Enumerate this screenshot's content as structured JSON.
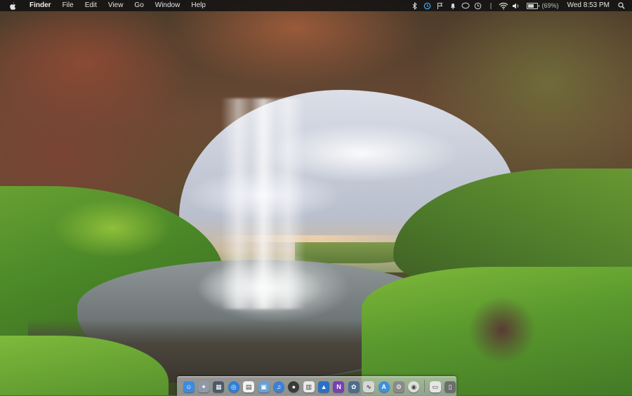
{
  "menubar": {
    "apple_icon": "apple-logo-icon",
    "items": [
      "Finder",
      "File",
      "Edit",
      "View",
      "Go",
      "Window",
      "Help"
    ],
    "status_icons": [
      "bluetooth-icon",
      "timemachine-icon",
      "flag-icon",
      "notification-bell-icon",
      "chat-icon",
      "clock-history-icon",
      "dropbox-icon",
      "wifi-icon",
      "volume-icon"
    ],
    "battery": {
      "percent_text": "(69%)",
      "level": 0.69
    },
    "clock": "Wed 8:53 PM",
    "search_icon": "spotlight-search-icon"
  },
  "dock": {
    "items": [
      {
        "name": "finder",
        "icon": "finder-icon",
        "color": "#3d8be0"
      },
      {
        "name": "launchpad",
        "icon": "launchpad-icon",
        "color": "#8f9aa8"
      },
      {
        "name": "mission-control",
        "icon": "mission-control-icon",
        "color": "#4b5a6b"
      },
      {
        "name": "safari",
        "icon": "safari-icon",
        "color": "#2f7fd8"
      },
      {
        "name": "calendar",
        "icon": "calendar-icon",
        "color": "#f2f2f2"
      },
      {
        "name": "preview",
        "icon": "preview-icon",
        "color": "#6aa0d8"
      },
      {
        "name": "itunes",
        "icon": "itunes-icon",
        "color": "#3c7fd6"
      },
      {
        "name": "photo-booth",
        "icon": "camera-icon",
        "color": "#3a3a3a"
      },
      {
        "name": "numbers",
        "icon": "numbers-icon",
        "color": "#e9e9e9"
      },
      {
        "name": "keynote",
        "icon": "keynote-icon",
        "color": "#2a6fc8"
      },
      {
        "name": "one-note",
        "icon": "onenote-icon",
        "color": "#7a3fb0"
      },
      {
        "name": "photos",
        "icon": "photos-icon",
        "color": "#4d6d8e"
      },
      {
        "name": "grapher",
        "icon": "grapher-icon",
        "color": "#d7d7d7"
      },
      {
        "name": "app-store",
        "icon": "app-store-icon",
        "color": "#3f8fe0"
      },
      {
        "name": "system-preferences",
        "icon": "system-preferences-icon",
        "color": "#8a8a8a"
      },
      {
        "name": "chrome",
        "icon": "chrome-icon",
        "color": "#e0e0e0"
      },
      {
        "name": "folder",
        "icon": "folder-icon",
        "color": "#e6e6e6"
      },
      {
        "name": "trash",
        "icon": "trash-icon",
        "color": "#6d6d6d"
      }
    ]
  }
}
